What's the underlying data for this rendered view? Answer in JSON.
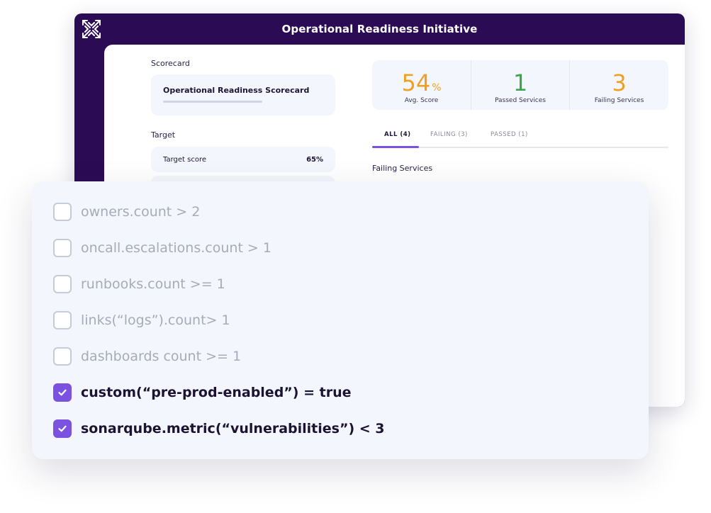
{
  "app": {
    "title": "Operational Readiness Initiative",
    "logo_icon": "x-logo-icon",
    "brand_color": "#2b0c54"
  },
  "scorecard": {
    "section_label": "Scorecard",
    "name": "Operational Readiness Scorecard"
  },
  "target": {
    "section_label": "Target",
    "name": "Target score",
    "value": "65%"
  },
  "stats": [
    {
      "value": "54",
      "unit": "%",
      "label": "Avg. Score",
      "color": "#f0a020"
    },
    {
      "value": "1",
      "unit": "",
      "label": "Passed Services",
      "color": "#3fa34d"
    },
    {
      "value": "3",
      "unit": "",
      "label": "Failing Services",
      "color": "#f0a020"
    }
  ],
  "tabs": [
    {
      "label": "ALL (4)",
      "active": true
    },
    {
      "label": "FAILING (3)",
      "active": false
    },
    {
      "label": "PASSED (1)",
      "active": false
    }
  ],
  "failing_section_label": "Failing Services",
  "checks": [
    {
      "label": "owners.count > 2",
      "checked": false
    },
    {
      "label": "oncall.escalations.count > 1",
      "checked": false
    },
    {
      "label": "runbooks.count >= 1",
      "checked": false
    },
    {
      "label": "links(“logs”).count> 1",
      "checked": false
    },
    {
      "label": "dashboards count >= 1",
      "checked": false
    },
    {
      "label": "custom(“pre-prod-enabled”) = true",
      "checked": true
    },
    {
      "label": "sonarqube.metric(“vulnerabilities”) < 3",
      "checked": true
    }
  ],
  "accent_color": "#7b52e0"
}
